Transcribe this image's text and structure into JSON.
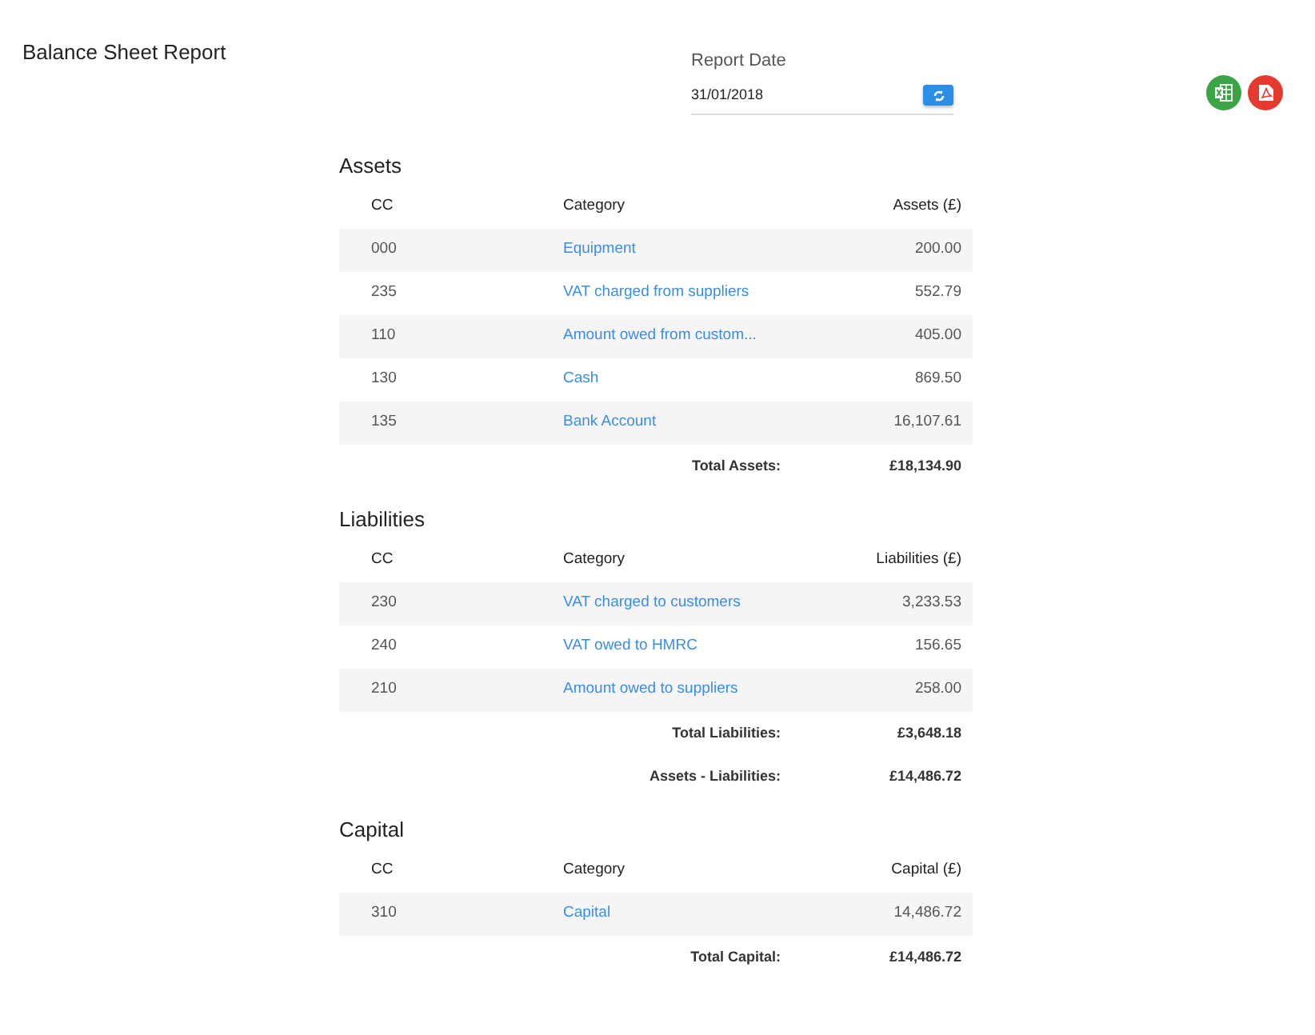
{
  "title": "Balance Sheet Report",
  "report_date": {
    "label": "Report Date",
    "value": "31/01/2018"
  },
  "sections": [
    {
      "title": "Assets",
      "columns": [
        "CC",
        "Category",
        "Assets (£)"
      ],
      "rows": [
        {
          "cc": "000",
          "category": "Equipment",
          "amount": "200.00"
        },
        {
          "cc": "235",
          "category": "VAT charged from suppliers",
          "amount": "552.79"
        },
        {
          "cc": "110",
          "category": "Amount owed from custom...",
          "amount": "405.00"
        },
        {
          "cc": "130",
          "category": "Cash",
          "amount": "869.50"
        },
        {
          "cc": "135",
          "category": "Bank Account",
          "amount": "16,107.61"
        }
      ],
      "totals": [
        {
          "label": "Total Assets:",
          "value": "£18,134.90"
        }
      ]
    },
    {
      "title": "Liabilities",
      "columns": [
        "CC",
        "Category",
        "Liabilities (£)"
      ],
      "rows": [
        {
          "cc": "230",
          "category": "VAT charged to customers",
          "amount": "3,233.53"
        },
        {
          "cc": "240",
          "category": "VAT owed to HMRC",
          "amount": "156.65"
        },
        {
          "cc": "210",
          "category": "Amount owed to suppliers",
          "amount": "258.00"
        }
      ],
      "totals": [
        {
          "label": "Total Liabilities:",
          "value": "£3,648.18"
        },
        {
          "label": "Assets - Liabilities:",
          "value": "£14,486.72"
        }
      ]
    },
    {
      "title": "Capital",
      "columns": [
        "CC",
        "Category",
        "Capital (£)"
      ],
      "rows": [
        {
          "cc": "310",
          "category": "Capital",
          "amount": "14,486.72"
        }
      ],
      "totals": [
        {
          "label": "Total Capital:",
          "value": "£14,486.72"
        }
      ]
    }
  ]
}
